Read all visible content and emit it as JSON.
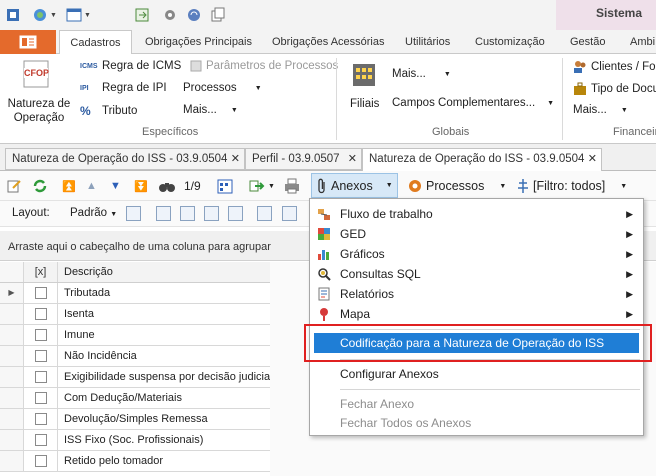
{
  "qat": {
    "system_title": "Sistema"
  },
  "ribbon_tabs": [
    "Cadastros",
    "Obrigações Principais",
    "Obrigações Acessórias",
    "Utilitários",
    "Customização",
    "Gestão",
    "Ambi"
  ],
  "ribbon": {
    "natureza": {
      "icon_text": "CFOP",
      "label_line1": "Natureza de",
      "label_line2": "Operação"
    },
    "especificos": {
      "items": [
        "Regra de ICMS",
        "Regra de IPI",
        "Tributo",
        "Parâmetros de Processos",
        "Processos",
        "Mais..."
      ],
      "label": "Específicos"
    },
    "globais": {
      "filiais": "Filiais",
      "mais": "Mais...",
      "campos": "Campos Complementares...",
      "label": "Globais"
    },
    "financeiro": {
      "items": [
        "Clientes / For",
        "Tipo de Docu",
        "Mais..."
      ],
      "label": "Financeir"
    },
    "icon_texts": {
      "icms": "ICMS",
      "ipi": "IPI"
    }
  },
  "doc_tabs": [
    "Natureza de Operação do ISS - 03.9.0504",
    "Perfil - 03.9.0507",
    "Natureza de Operação do ISS - 03.9.0504"
  ],
  "toolbar": {
    "page_indicator": "1/9",
    "anexos": "Anexos",
    "processos": "Processos",
    "filtro": "[Filtro: todos]"
  },
  "layoutbar": {
    "layout_label": "Layout:",
    "layout_value": "Padrão"
  },
  "groupbar_text": "Arraste aqui o cabeçalho de uma coluna para agrupar",
  "grid": {
    "headers": {
      "check": "[x]",
      "desc": "Descrição"
    },
    "rows": [
      "Tributada",
      "Isenta",
      "Imune",
      "Não Incidência",
      "Exigibilidade suspensa por decisão judicial",
      "Com Dedução/Materiais",
      "Devolução/Simples Remessa",
      "ISS Fixo (Soc. Profissionais)",
      "Retido pelo tomador"
    ]
  },
  "menu": {
    "items": [
      {
        "label": "Fluxo de trabalho",
        "icon": "workflow-icon"
      },
      {
        "label": "GED",
        "icon": "ged-icon"
      },
      {
        "label": "Gráficos",
        "icon": "chart-icon"
      },
      {
        "label": "Consultas SQL",
        "icon": "sql-query-icon"
      },
      {
        "label": "Relatórios",
        "icon": "report-icon"
      },
      {
        "label": "Mapa",
        "icon": "map-pin-icon"
      }
    ],
    "highlighted": "Codificação para a Natureza de Operação do ISS",
    "configure": "Configurar Anexos",
    "close": "Fechar Anexo",
    "close_all": "Fechar Todos os Anexos"
  },
  "colors": {
    "accent": "#e46a2c",
    "highlight": "#1f7ed6",
    "annotation": "#e02020"
  }
}
